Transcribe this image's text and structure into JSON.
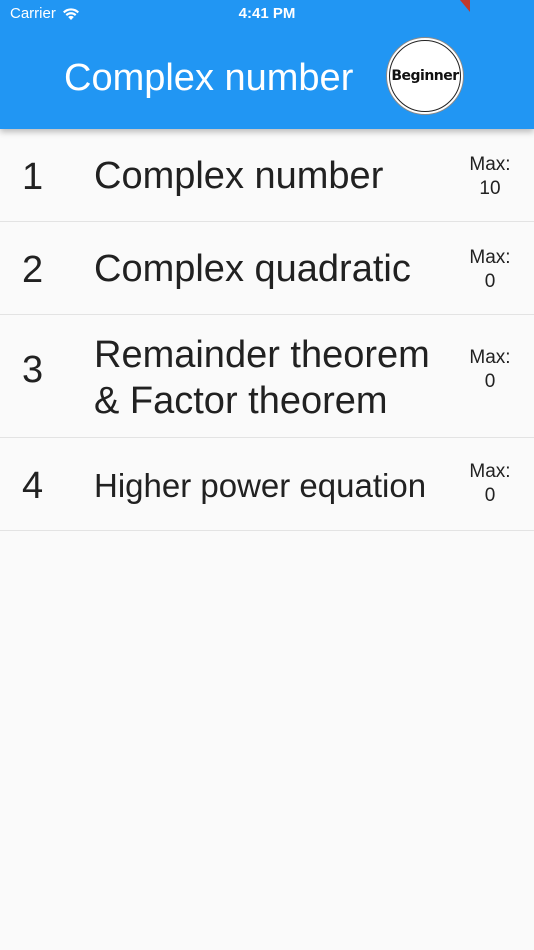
{
  "status_bar": {
    "carrier": "Carrier",
    "time": "4:41 PM",
    "wifi_icon": "wifi-icon"
  },
  "app_bar": {
    "title": "Complex number",
    "level_badge": "Beginner",
    "background_color": "#2196f3"
  },
  "items": [
    {
      "index": "1",
      "title_line1": "Complex number",
      "title_line2": "",
      "max_label": "Max:",
      "max_value": "10"
    },
    {
      "index": "2",
      "title_line1": "Complex quadratic",
      "title_line2": "",
      "max_label": "Max:",
      "max_value": "0"
    },
    {
      "index": "3",
      "title_line1": "Remainder theorem",
      "title_line2": "& Factor theorem",
      "max_label": "Max:",
      "max_value": "0"
    },
    {
      "index": "4",
      "title_line1": "Higher power equation",
      "title_line2": "",
      "max_label": "Max:",
      "max_value": "0"
    }
  ]
}
